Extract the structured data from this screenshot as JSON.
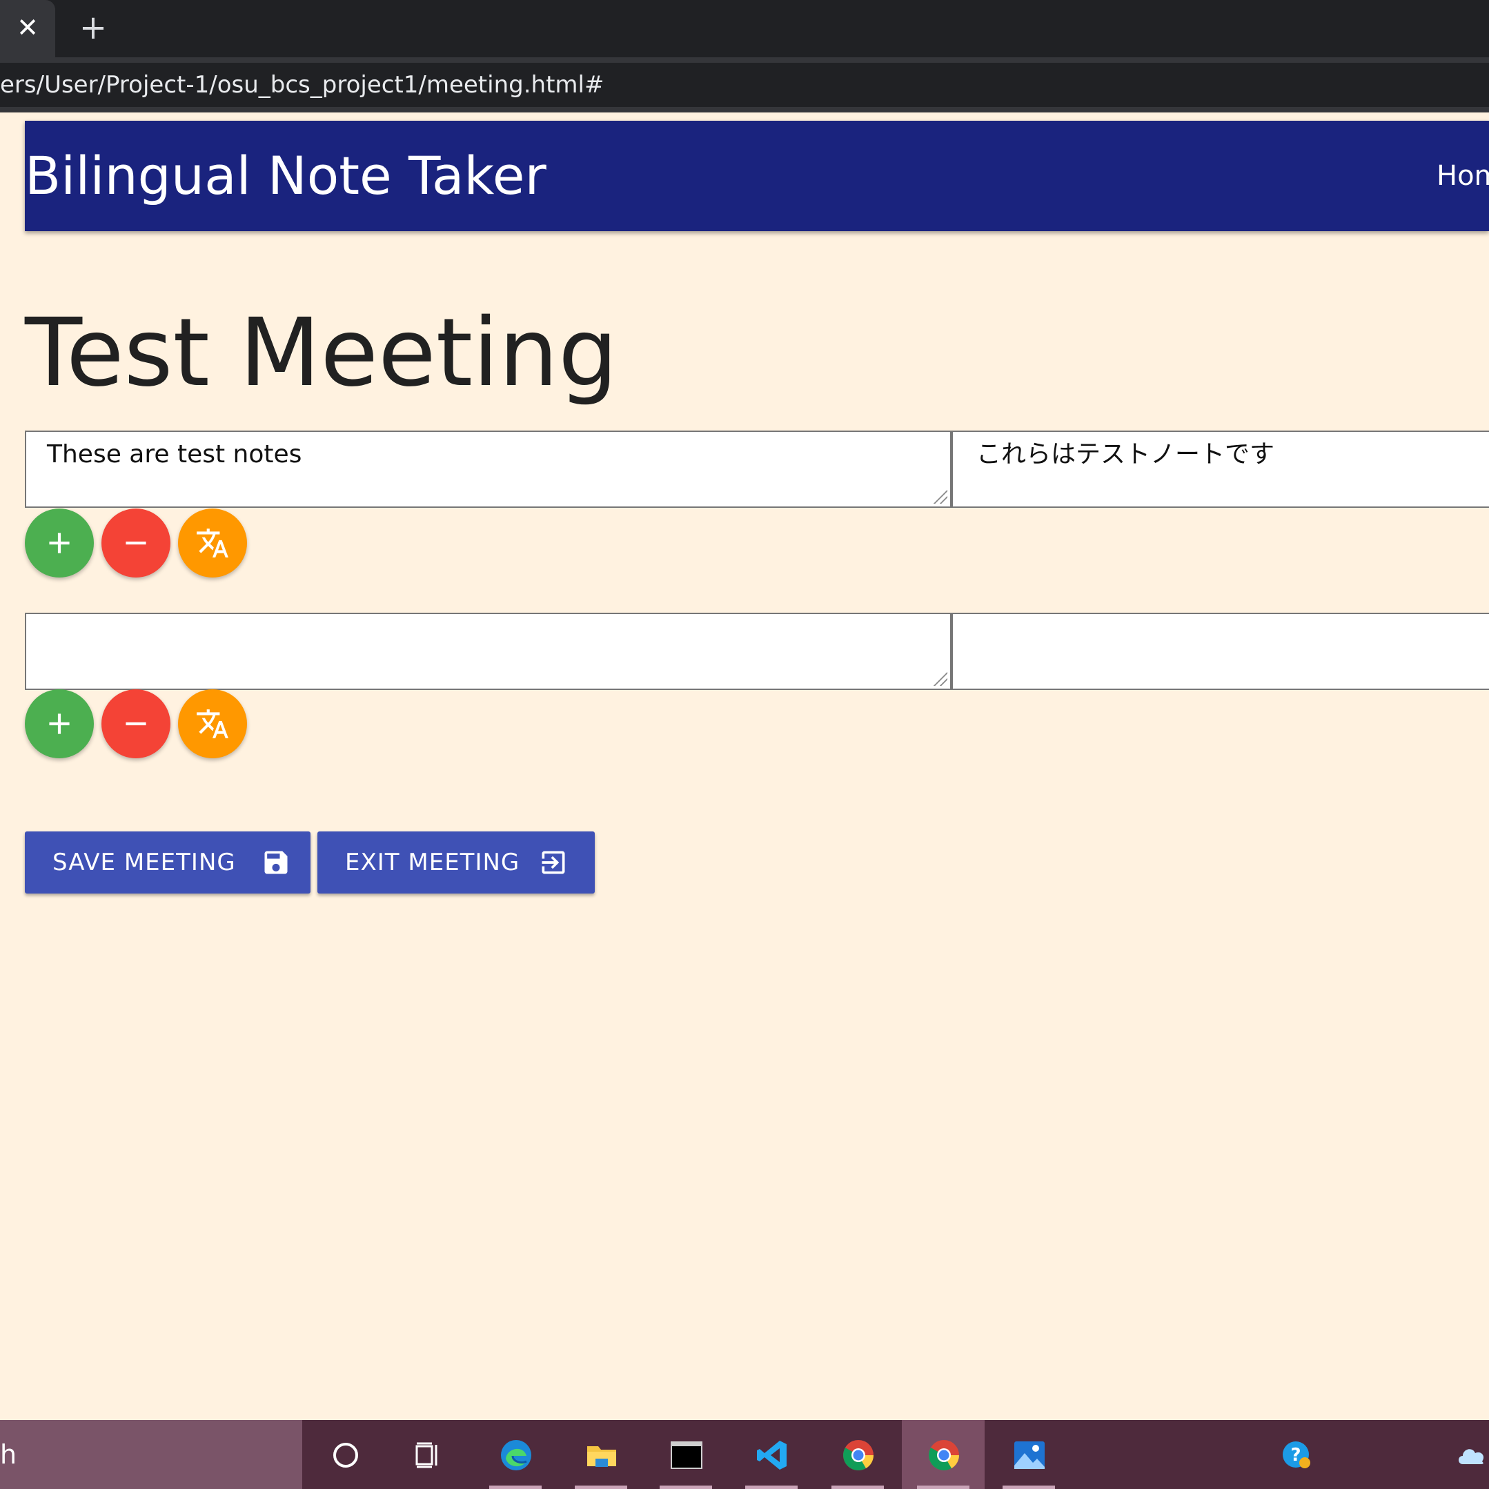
{
  "browser": {
    "tab_close_glyph": "✕",
    "new_tab_glyph": "+",
    "address": "ers/User/Project-1/osu_bcs_project1/meeting.html#"
  },
  "header": {
    "brand": "Bilingual Note Taker",
    "nav_home": "Hom"
  },
  "meeting": {
    "title": "Test Meeting",
    "notes": [
      {
        "original": "These are test notes",
        "translation": "これらはテストノートです"
      },
      {
        "original": "",
        "translation": ""
      }
    ]
  },
  "actions": {
    "save_label": "SAVE MEETING",
    "exit_label": "EXIT MEETING"
  },
  "icons": {
    "add": "plus-icon",
    "remove": "minus-icon",
    "translate": "translate-icon",
    "save": "floppy-disk-icon",
    "exit": "exit-to-app-icon"
  },
  "colors": {
    "page_bg": "#fff2e0",
    "header_bg": "#1a237e",
    "add": "#4caf50",
    "remove": "#f44336",
    "translate": "#ff9800",
    "action_button": "#3f51b5",
    "taskbar": "#4e2a3c"
  },
  "taskbar": {
    "search_text": "h",
    "apps": [
      "cortana",
      "task-view",
      "edge",
      "file-explorer",
      "terminal",
      "vscode",
      "chrome",
      "chrome",
      "photos",
      "help",
      "onedrive"
    ]
  }
}
